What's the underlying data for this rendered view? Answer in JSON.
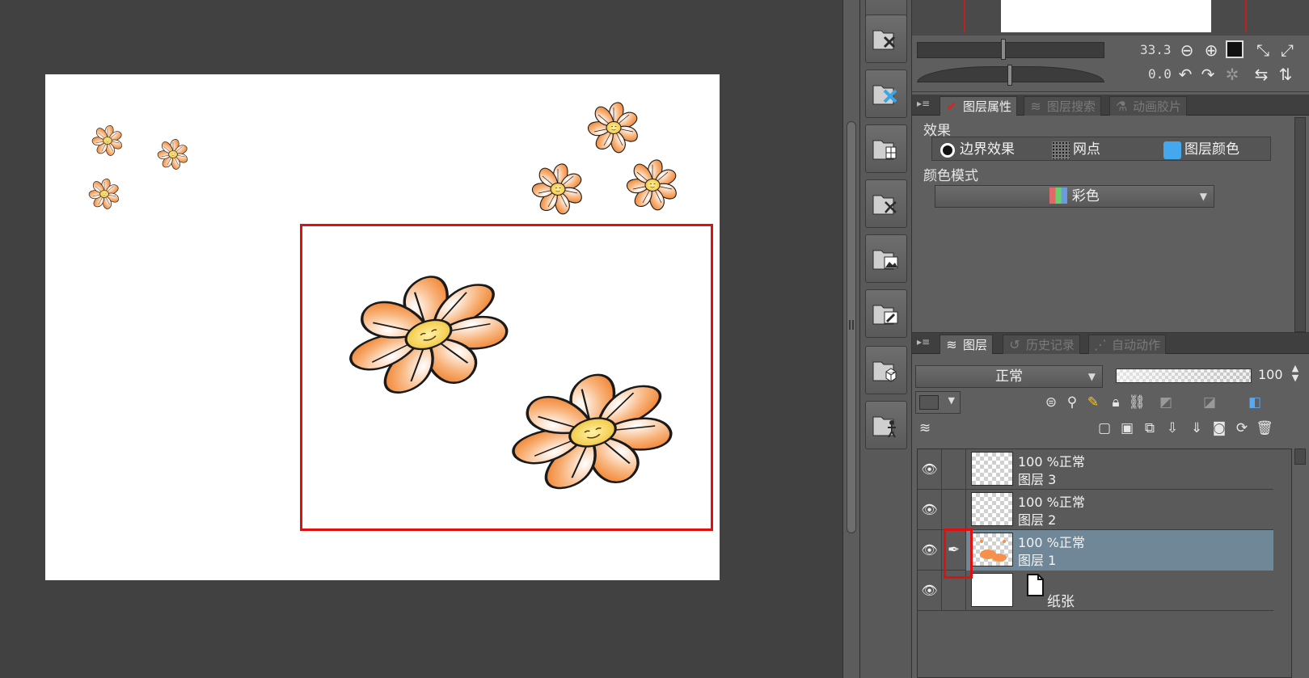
{
  "navigator": {
    "zoom_value": "33.3",
    "rotate_value": "0.0"
  },
  "props_panel": {
    "tabs": [
      {
        "label": "图层属性",
        "active": true
      },
      {
        "label": "图层搜索",
        "active": false
      },
      {
        "label": "动画胶片",
        "active": false
      }
    ],
    "effect_section_label": "效果",
    "effects": [
      {
        "label": "边界效果",
        "icon": "border-effect-icon"
      },
      {
        "label": "网点",
        "icon": "halftone-icon"
      },
      {
        "label": "图层颜色",
        "icon": "layer-color-icon"
      }
    ],
    "color_mode_label": "颜色模式",
    "color_mode_value": "彩色"
  },
  "layer_panel": {
    "tabs": [
      {
        "label": "图层",
        "active": true
      },
      {
        "label": "历史记录",
        "active": false
      },
      {
        "label": "自动动作",
        "active": false
      }
    ],
    "blend_mode": "正常",
    "opacity": "100",
    "layers": [
      {
        "mode": "100 %正常",
        "name": "图层 3",
        "selected": false
      },
      {
        "mode": "100 %正常",
        "name": "图层 2",
        "selected": false
      },
      {
        "mode": "100 %正常",
        "name": "图层 1",
        "selected": true
      }
    ],
    "paper_layer_name": "纸张"
  },
  "colors": {
    "highlight": "#e01010",
    "selected_layer": "#6f8797",
    "petal": "#f5914a",
    "center": "#f3d24a"
  }
}
